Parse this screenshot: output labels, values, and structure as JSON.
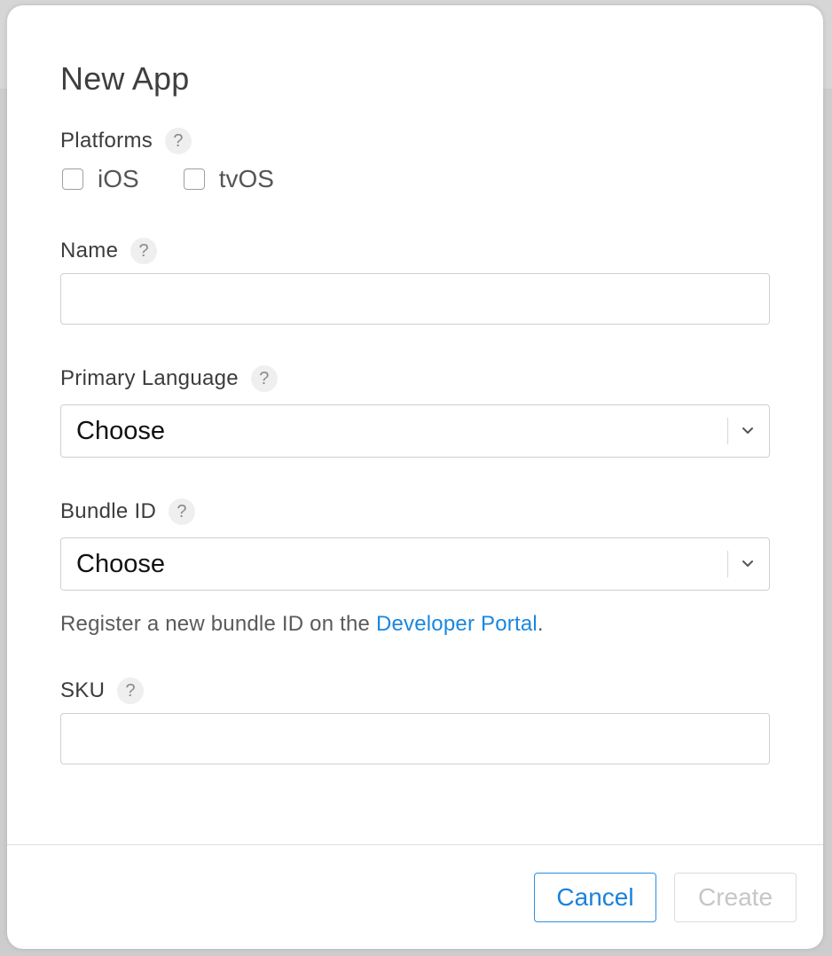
{
  "dialog": {
    "title": "New App"
  },
  "platforms": {
    "label": "Platforms",
    "help_icon": "question-mark",
    "options": [
      {
        "label": "iOS",
        "checked": false
      },
      {
        "label": "tvOS",
        "checked": false
      }
    ]
  },
  "name": {
    "label": "Name",
    "help_icon": "question-mark",
    "value": "",
    "placeholder": ""
  },
  "primary_language": {
    "label": "Primary Language",
    "help_icon": "question-mark",
    "selected": "Choose",
    "icon": "chevron-down-icon"
  },
  "bundle_id": {
    "label": "Bundle ID",
    "help_icon": "question-mark",
    "selected": "Choose",
    "icon": "chevron-down-icon",
    "helper_prefix": "Register a new bundle ID on the ",
    "helper_link": "Developer Portal",
    "helper_suffix": "."
  },
  "sku": {
    "label": "SKU",
    "help_icon": "question-mark",
    "value": "",
    "placeholder": ""
  },
  "footer": {
    "cancel_label": "Cancel",
    "create_label": "Create",
    "create_enabled": false
  },
  "colors": {
    "accent": "#1a82dc",
    "link": "#1a87e0",
    "disabled_text": "#c6c6c6",
    "border": "#cfcfcf"
  },
  "help_glyph": "?"
}
